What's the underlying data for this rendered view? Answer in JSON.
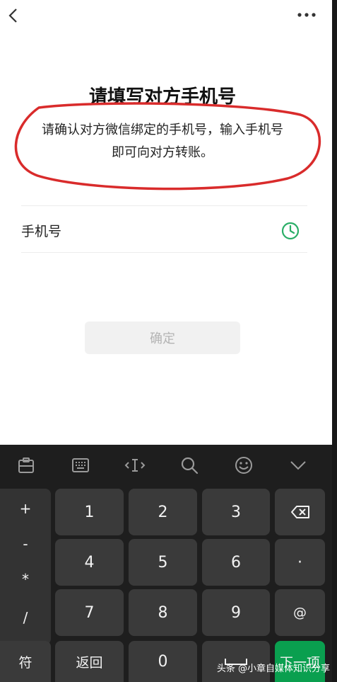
{
  "page": {
    "title": "请填写对方手机号",
    "description_line1": "请确认对方微信绑定的手机号，输入手机号",
    "description_line2": "即可向对方转账。",
    "phone_label": "手机号",
    "phone_value": "",
    "confirm_label": "确定",
    "accent_green": "#2aae67",
    "annotation_red": "#d92b2b"
  },
  "keyboard": {
    "toolbar_icons": [
      "clipboard-icon",
      "keyboard-icon",
      "cursor-icon",
      "search-icon",
      "emoji-icon",
      "collapse-icon"
    ],
    "side_keys": [
      "+",
      "-",
      "*",
      "/"
    ],
    "digits": [
      "1",
      "2",
      "3",
      "4",
      "5",
      "6",
      "7",
      "8",
      "9",
      "0"
    ],
    "symbol_label": "符",
    "return_label": "返回",
    "dot_label": "·",
    "at_label": "@",
    "next_label": "下一项",
    "accent_green": "#0a9f4f"
  },
  "watermark": "头条 @小章自媒体知识分享"
}
